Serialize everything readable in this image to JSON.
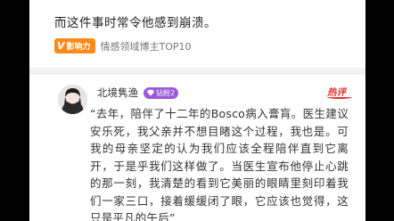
{
  "top_text": "而这件事时常令他感到崩溃。",
  "badge": {
    "label": "影响力",
    "text": "情感领域博主TOP10"
  },
  "author": {
    "name": "北境隽渔",
    "vip_label": "钻粉2"
  },
  "hot_tag": "热评",
  "article_text": "“去年，陪伴了十二年的Bosco病入膏肓。医生建议安乐死，我父亲并不想目睹这个过程，我也是。可我的母亲坚定的认为我们应该全程陪伴直到它离开，于是乎我们这样做了。当医生宣布他停止心跳的那一刻，我清楚的看到它美丽的眼睛里刻印着我们一家三口，接着缓缓闭了眼，它应该也觉得，这只是平凡的午后”",
  "colors": {
    "badge": "#ff8a1a",
    "vip": "#9b59d9",
    "hot": "#e0352b"
  }
}
